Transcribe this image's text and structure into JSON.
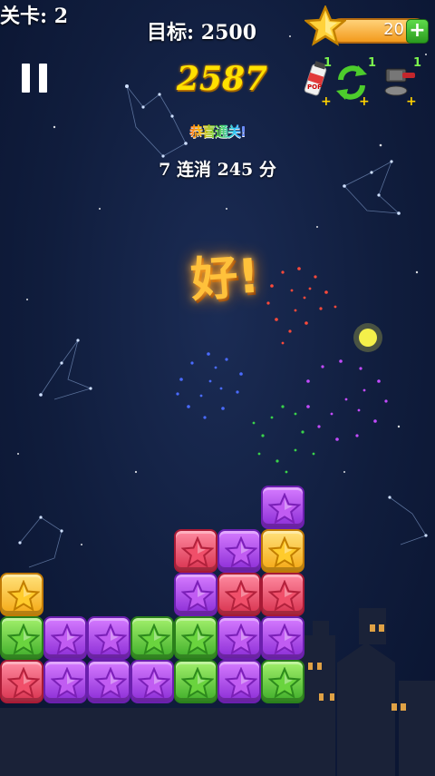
{
  "hud": {
    "level": "关卡: 2",
    "target": "目标: 2500",
    "coins": "20",
    "plus": "+",
    "score": "2587"
  },
  "tools": [
    {
      "name": "pop-hammer-tool",
      "count": "1",
      "label": "POP"
    },
    {
      "name": "refresh-tool",
      "count": "1"
    },
    {
      "name": "bomb-hammer-tool",
      "count": "1"
    }
  ],
  "messages": {
    "clear_banner": "恭喜通关!",
    "combo": "7 连消 245 分",
    "praise": "好!"
  },
  "colors": {
    "purple": "#a94be8",
    "red": "#e24a64",
    "green": "#5cc43a",
    "yellow": "#f8c23a"
  },
  "board": {
    "rows": [
      [
        "",
        "",
        "",
        "",
        "",
        "",
        "purple",
        "",
        "",
        ""
      ],
      [
        "",
        "",
        "",
        "",
        "red",
        "purple",
        "yellow",
        "",
        "",
        ""
      ],
      [
        "yellow",
        "",
        "",
        "",
        "purple",
        "red",
        "red",
        "",
        "",
        ""
      ],
      [
        "green",
        "purple",
        "purple",
        "green",
        "green",
        "purple",
        "purple",
        "",
        "",
        ""
      ],
      [
        "red",
        "purple",
        "purple",
        "purple",
        "green",
        "purple",
        "green",
        "",
        "",
        ""
      ]
    ]
  }
}
